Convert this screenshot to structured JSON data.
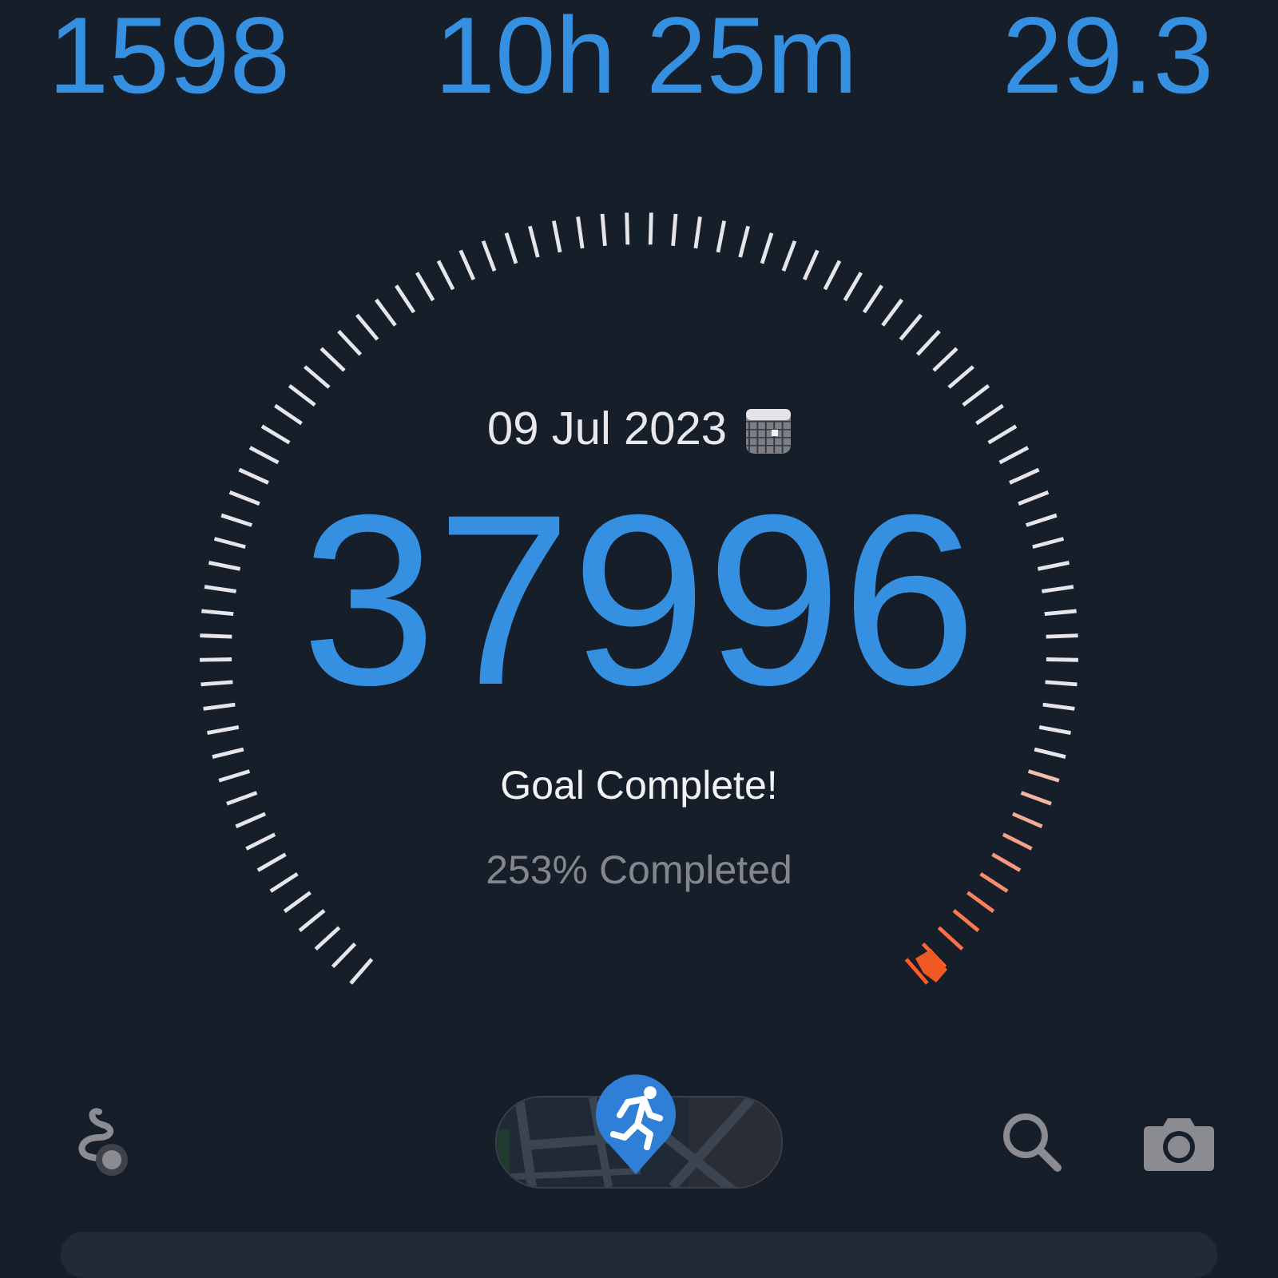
{
  "stats": [
    {
      "value": "1598"
    },
    {
      "value": "10h 25m"
    },
    {
      "value": "29.3"
    }
  ],
  "gauge": {
    "date": "09 Jul 2023",
    "steps": "37996",
    "status": "Goal Complete!",
    "percent": "253% Completed"
  }
}
